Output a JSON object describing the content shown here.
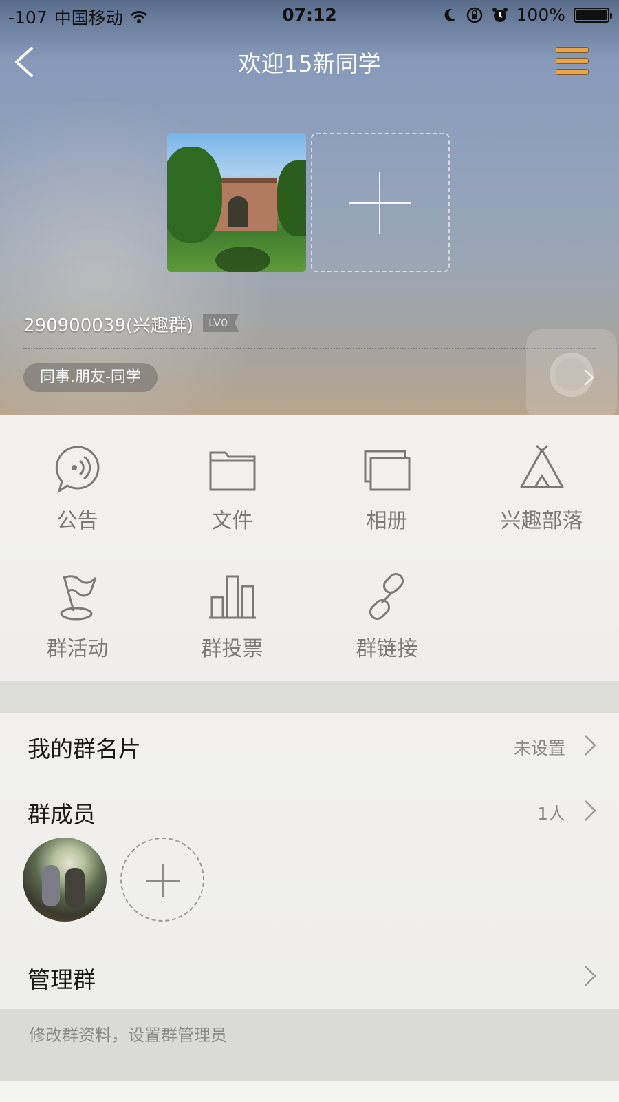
{
  "status_bar": {
    "signal": "-107",
    "carrier": "中国移动",
    "time": "07:12",
    "battery": "100%"
  },
  "navbar": {
    "title": "欢迎15新同学"
  },
  "header": {
    "group_id": "290900039(兴趣群)",
    "level_badge": "LV0",
    "category_tag": "同事.朋友-同学"
  },
  "grid": {
    "items": [
      {
        "label": "公告",
        "icon": "announcement-icon"
      },
      {
        "label": "文件",
        "icon": "folder-icon"
      },
      {
        "label": "相册",
        "icon": "album-icon"
      },
      {
        "label": "兴趣部落",
        "icon": "tent-icon"
      },
      {
        "label": "群活动",
        "icon": "flag-icon"
      },
      {
        "label": "群投票",
        "icon": "bar-chart-icon"
      },
      {
        "label": "群链接",
        "icon": "link-icon"
      }
    ]
  },
  "list": {
    "card_label": "我的群名片",
    "card_value": "未设置",
    "members_label": "群成员",
    "members_count": "1人",
    "manage_label": "管理群",
    "manage_hint": "修改群资料，设置群管理员"
  },
  "colors": {
    "menu_icon": "#e9a44c",
    "icon_gray": "#7a7a7a"
  }
}
